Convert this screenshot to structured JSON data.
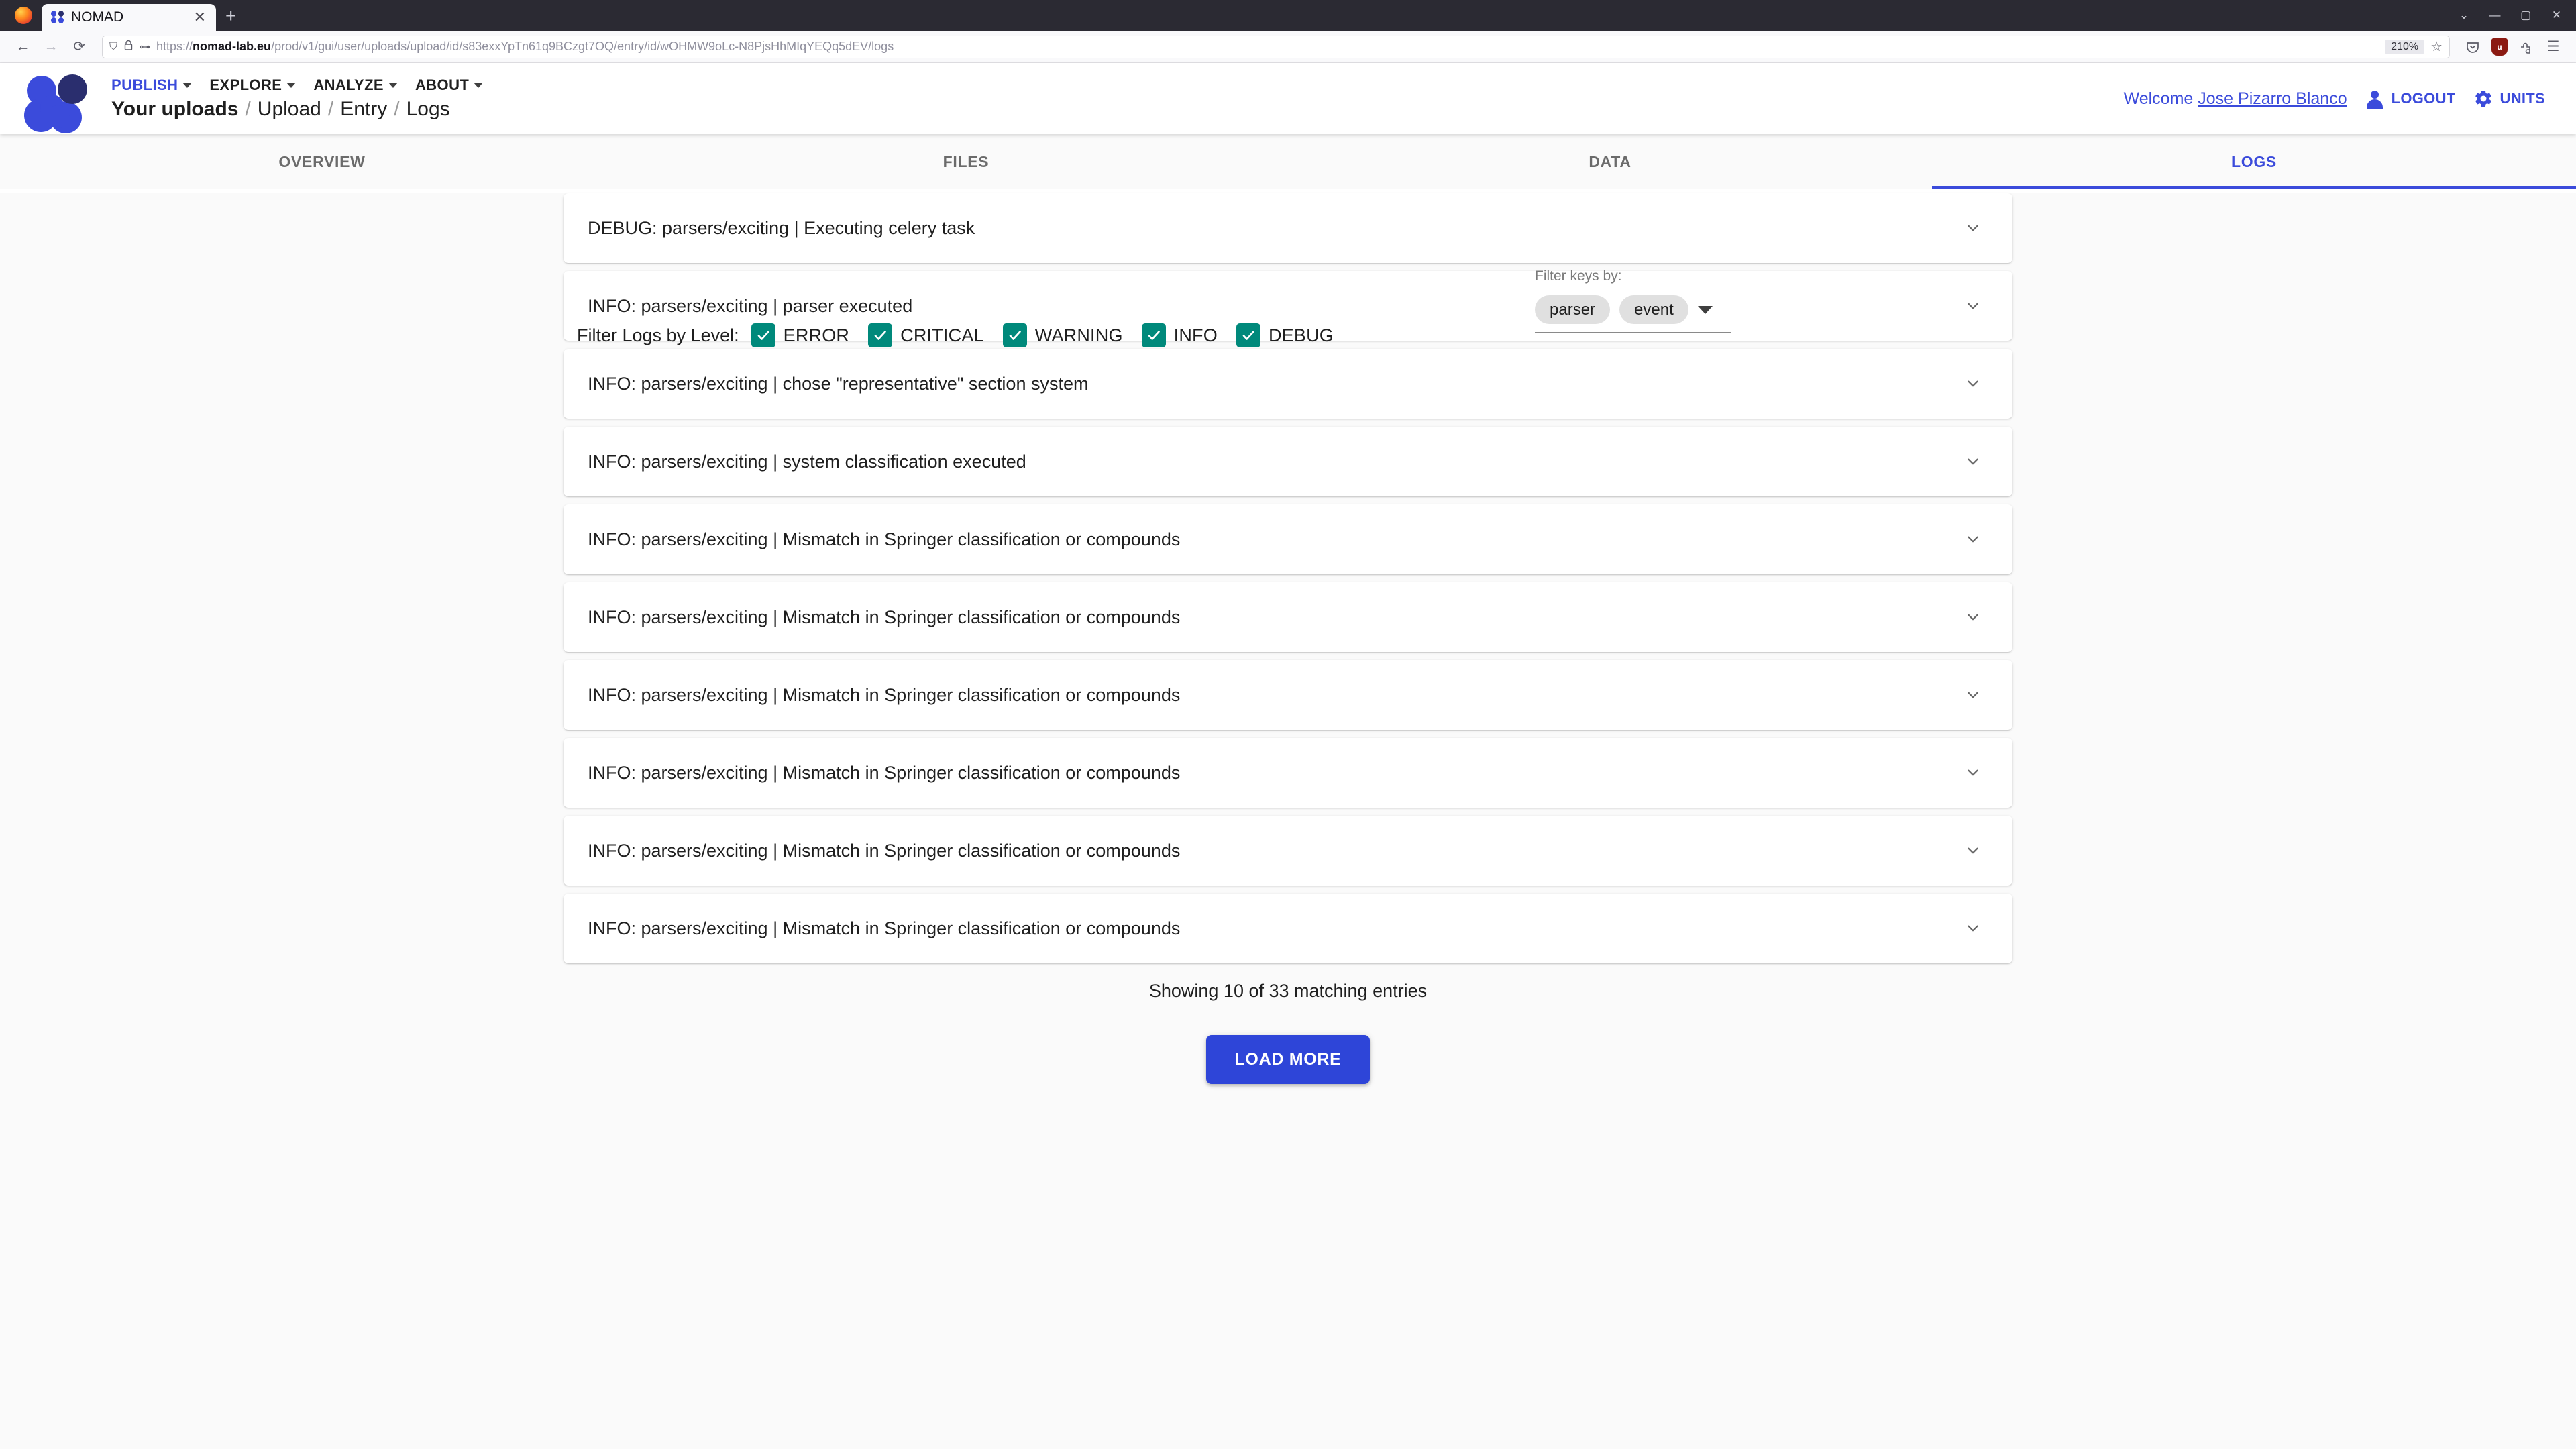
{
  "browser": {
    "tab_title": "NOMAD",
    "tab_close_glyph": "✕",
    "new_tab_glyph": "+",
    "back_glyph": "←",
    "forward_glyph": "→",
    "reload_glyph": "⟳",
    "shield_glyph": "⛉",
    "lock_glyph": "🔒",
    "perms_glyph": "⊶",
    "url_prefix": "https://",
    "url_domain": "nomad-lab.eu",
    "url_path": "/prod/v1/gui/user/uploads/upload/id/s83exxYpTn61q9BCzgt7OQ/entry/id/wOHMW9oLc-N8PjsHhMIqYEQq5dEV/logs",
    "zoom_level": "210%",
    "star_glyph": "☆",
    "pocket_glyph": "⌄",
    "ublock_glyph": "u",
    "extensions_glyph": "⛊",
    "menu_glyph": "☰",
    "minimize_glyph": "—",
    "maximize_glyph": "▢",
    "close_glyph": "✕",
    "restore_glyph": "⌄"
  },
  "header": {
    "nav": [
      {
        "label": "PUBLISH",
        "active": true
      },
      {
        "label": "EXPLORE",
        "active": false
      },
      {
        "label": "ANALYZE",
        "active": false
      },
      {
        "label": "ABOUT",
        "active": false
      }
    ],
    "breadcrumb": {
      "current": "Your uploads",
      "sep": "/",
      "items": [
        "Upload",
        "Entry",
        "Logs"
      ]
    },
    "welcome_prefix": "Welcome ",
    "user_name": "Jose Pizarro Blanco",
    "logout_label": "LOGOUT",
    "units_label": "UNITS",
    "accent_color": "#3b4bdb"
  },
  "tabs": [
    {
      "label": "OVERVIEW",
      "active": false
    },
    {
      "label": "FILES",
      "active": false
    },
    {
      "label": "DATA",
      "active": false
    },
    {
      "label": "LOGS",
      "active": true
    }
  ],
  "filters": {
    "level_label": "Filter Logs by Level:",
    "levels": [
      {
        "label": "ERROR",
        "checked": true
      },
      {
        "label": "CRITICAL",
        "checked": true
      },
      {
        "label": "WARNING",
        "checked": true
      },
      {
        "label": "INFO",
        "checked": true
      },
      {
        "label": "DEBUG",
        "checked": true
      }
    ],
    "checkbox_color": "#00897b",
    "keys_label": "Filter keys by:",
    "keys_chips": [
      "parser",
      "event"
    ]
  },
  "logs": {
    "entries": [
      {
        "text": "DEBUG: parsers/exciting | Executing celery task",
        "level": "DEBUG"
      },
      {
        "text": "INFO: parsers/exciting | parser executed",
        "level": "INFO"
      },
      {
        "text": "INFO: parsers/exciting | chose \"representative\" section system",
        "level": "INFO"
      },
      {
        "text": "INFO: parsers/exciting | system classification executed",
        "level": "INFO"
      },
      {
        "text": "INFO: parsers/exciting | Mismatch in Springer classification or compounds",
        "level": "INFO"
      },
      {
        "text": "INFO: parsers/exciting | Mismatch in Springer classification or compounds",
        "level": "INFO"
      },
      {
        "text": "INFO: parsers/exciting | Mismatch in Springer classification or compounds",
        "level": "INFO"
      },
      {
        "text": "INFO: parsers/exciting | Mismatch in Springer classification or compounds",
        "level": "INFO"
      },
      {
        "text": "INFO: parsers/exciting | Mismatch in Springer classification or compounds",
        "level": "INFO"
      },
      {
        "text": "INFO: parsers/exciting | Mismatch in Springer classification or compounds",
        "level": "INFO"
      }
    ],
    "showing_text": "Showing 10 of 33 matching entries",
    "load_more_label": "LOAD MORE",
    "load_more_color": "#2e45d8"
  }
}
